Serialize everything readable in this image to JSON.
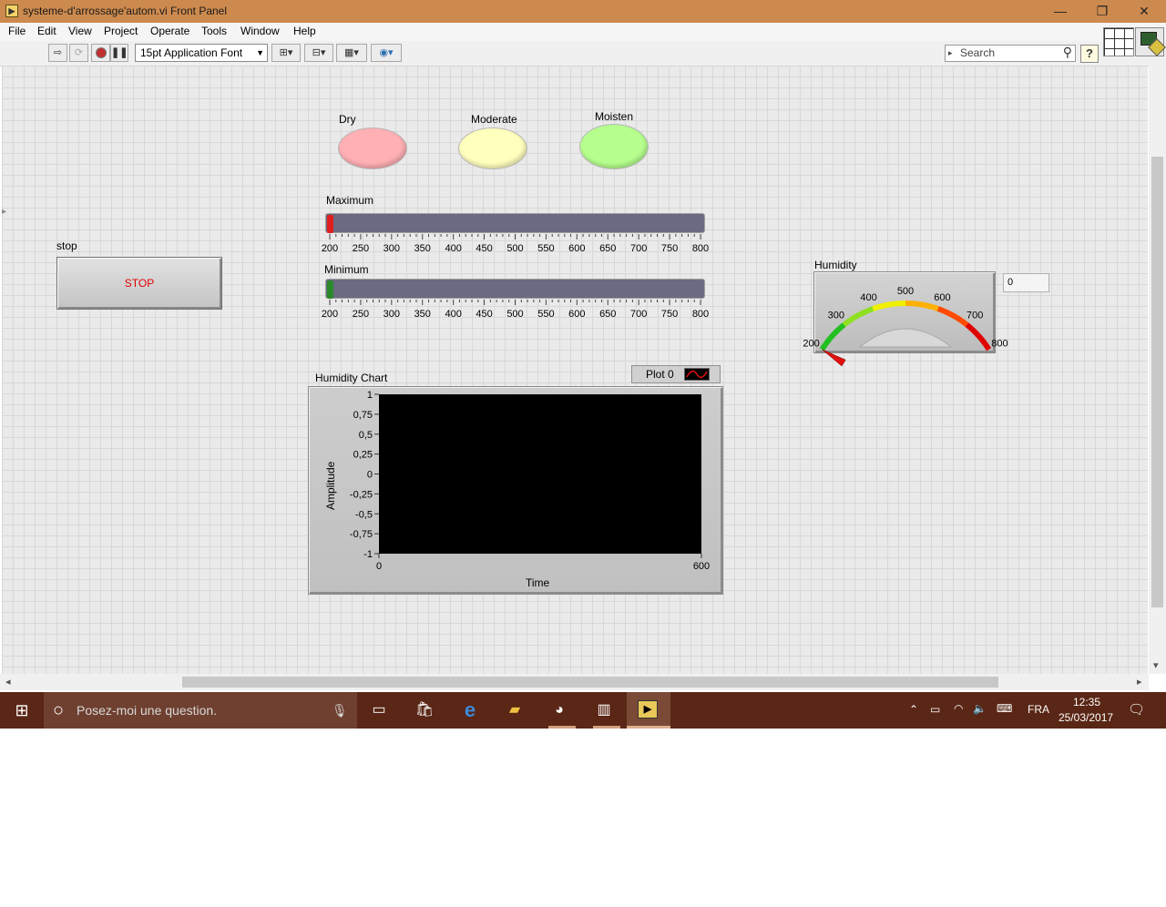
{
  "window": {
    "title": "systeme-d'arrossage'autom.vi Front Panel",
    "minimize_glyph": "—",
    "restore_glyph": "❐",
    "close_glyph": "✕"
  },
  "menu": [
    "File",
    "Edit",
    "View",
    "Project",
    "Operate",
    "Tools",
    "Window",
    "Help"
  ],
  "toolbar": {
    "font_select": "15pt Application Font",
    "search_placeholder": "Search"
  },
  "leds": {
    "dry": {
      "label": "Dry",
      "color": "#ffb0b4"
    },
    "moderate": {
      "label": "Moderate",
      "color": "#ffffbe"
    },
    "moisten": {
      "label": "Moisten",
      "color": "#b6ff8e"
    }
  },
  "sliders": {
    "maximum": {
      "label": "Maximum",
      "value": 200,
      "knob_color": "#e02020"
    },
    "minimum": {
      "label": "Minimum",
      "value": 200,
      "knob_color": "#2a8a2a"
    },
    "scale": [
      "200",
      "250",
      "300",
      "350",
      "400",
      "450",
      "500",
      "550",
      "600",
      "650",
      "700",
      "750",
      "800"
    ]
  },
  "stop": {
    "label": "stop",
    "button_text": "STOP"
  },
  "gauge": {
    "label": "Humidity",
    "value": 200,
    "numeric_display": "0",
    "scale": [
      "200",
      "300",
      "400",
      "500",
      "600",
      "700",
      "800"
    ]
  },
  "chart_data": {
    "type": "line",
    "title": "Humidity Chart",
    "xlabel": "Time",
    "ylabel": "Amplitude",
    "xlim": [
      0,
      600
    ],
    "ylim": [
      -1,
      1
    ],
    "x_ticks": [
      "0",
      "600"
    ],
    "y_ticks": [
      "1",
      "0,75",
      "0,5",
      "0,25",
      "0",
      "-0,25",
      "-0,5",
      "-0,75",
      "-1"
    ],
    "series": [
      {
        "name": "Plot 0",
        "values": []
      }
    ],
    "legend": "top-right"
  },
  "taskbar": {
    "cortana_text": "Posez-moi une question.",
    "language": "FRA",
    "time": "12:35",
    "date": "25/03/2017"
  }
}
